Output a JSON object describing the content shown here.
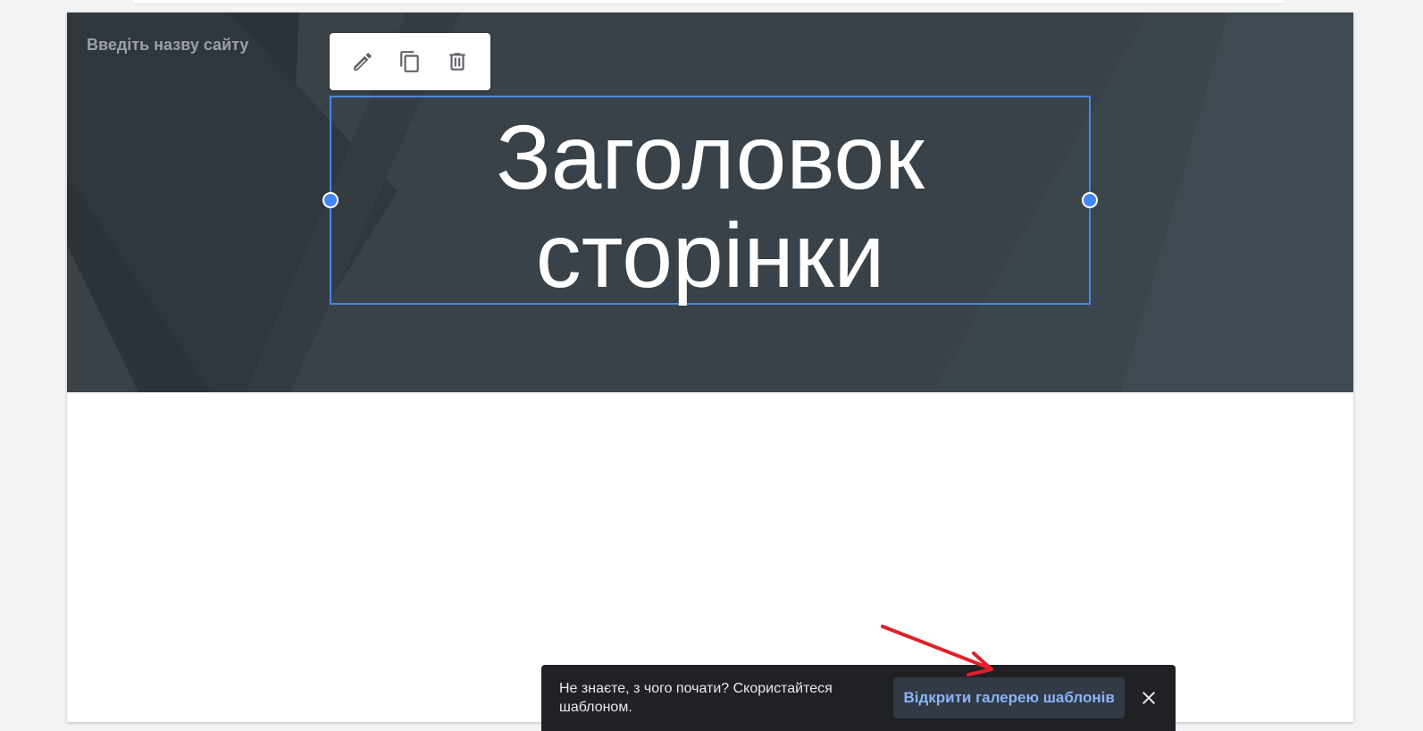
{
  "header": {
    "site_name_placeholder": "Введіть назву сайту",
    "title_line1": "Заголовок",
    "title_line2": "сторінки"
  },
  "toolbar": {
    "icons": [
      "pencil-icon",
      "copy-icon",
      "trash-icon"
    ]
  },
  "snackbar": {
    "message": "Не знаєте, з чого почати? Скористайтеся шаблоном.",
    "action_label": "Відкрити галерею шаблонів",
    "close_icon": "close-icon"
  },
  "colors": {
    "banner": "#374047",
    "selection": "#4a86e8",
    "snackbar_bg": "#202124",
    "link": "#8ab4f8",
    "annotation_arrow": "#e0202a"
  }
}
